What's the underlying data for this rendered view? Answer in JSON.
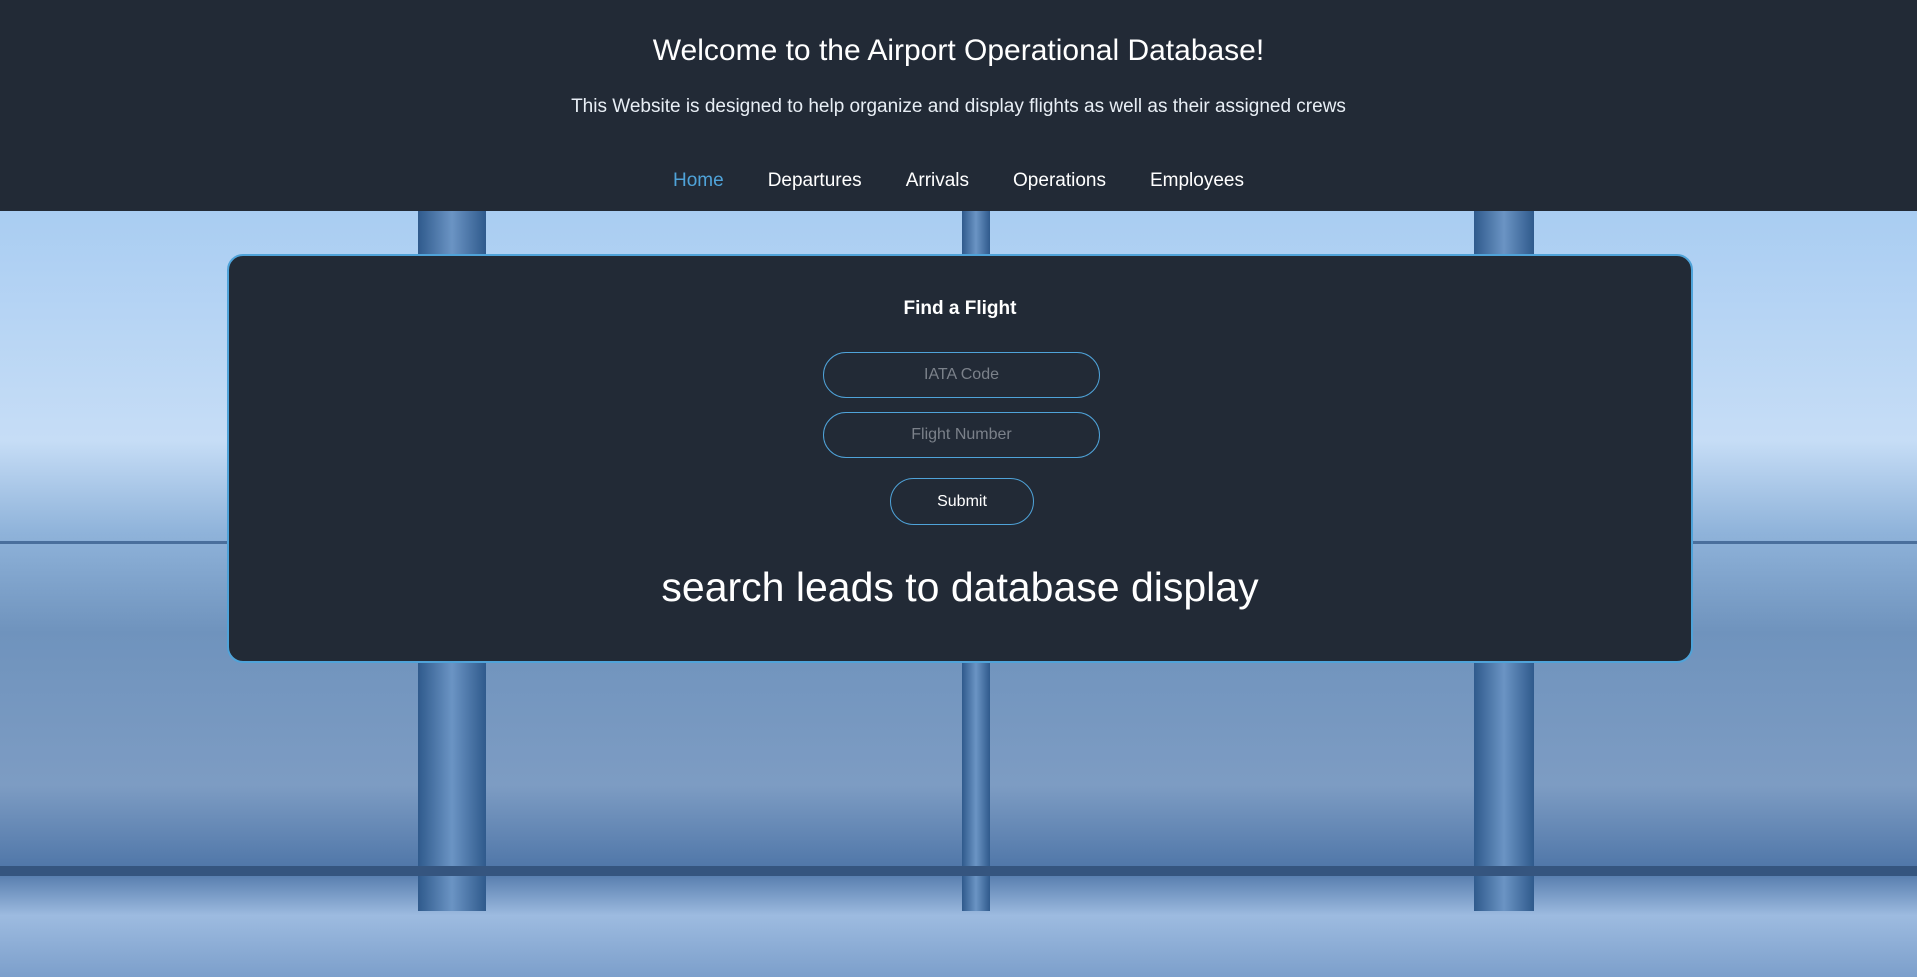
{
  "header": {
    "title": "Welcome to the Airport Operational Database!",
    "subtitle": "This Website is designed to help organize and display flights as well as their assigned crews"
  },
  "nav": {
    "items": [
      {
        "label": "Home",
        "active": true
      },
      {
        "label": "Departures"
      },
      {
        "label": "Arrivals"
      },
      {
        "label": "Operations"
      },
      {
        "label": "Employees"
      }
    ]
  },
  "search": {
    "title": "Find a Flight",
    "iata_placeholder": "IATA Code",
    "iata_value": "",
    "flight_placeholder": "Flight Number",
    "flight_value": "",
    "submit_label": "Submit",
    "note": "search leads to database display"
  },
  "colors": {
    "background": "#222a36",
    "accent": "#4fa3d9"
  }
}
